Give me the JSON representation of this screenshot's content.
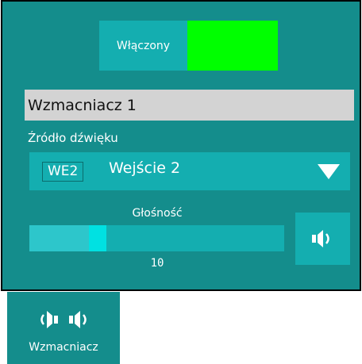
{
  "power": {
    "label": "Włączony",
    "state": "on",
    "indicator_color": "#00ff00"
  },
  "amplifier": {
    "name": "Wzmacniacz 1"
  },
  "source": {
    "caption": "Źródło dźwięku",
    "selected_code": "WE2",
    "selected_name": "Wejście 2"
  },
  "volume": {
    "caption": "Głośność",
    "value": "10",
    "level_fraction": 0.25
  },
  "icons": {
    "mute": "speaker-icon",
    "stereo_left": "speaker-left-icon",
    "stereo_right": "speaker-right-icon"
  },
  "mode": {
    "label": "Wzmacniacz"
  },
  "colors": {
    "panel": "#148d8c",
    "accent": "#14aeb0",
    "thumb": "#00e1e2",
    "field": "#d3d3d3",
    "power_on": "#00ff00"
  }
}
